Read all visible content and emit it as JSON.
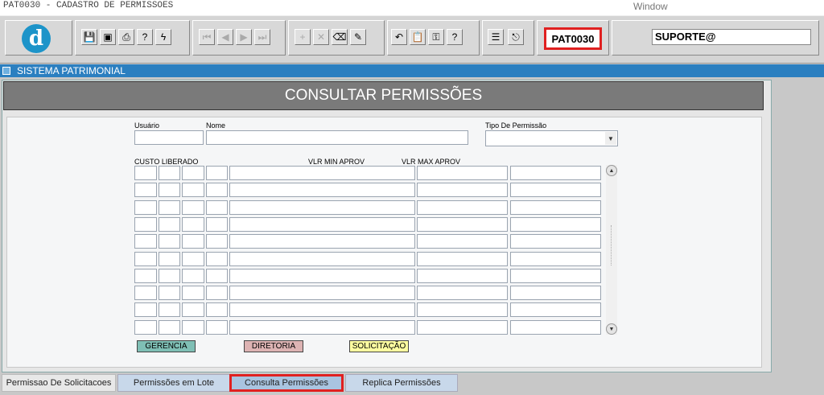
{
  "window": {
    "title": "PAT0030 - CADASTRO DE PERMISSOES",
    "menu_window": "Window"
  },
  "toolbar": {
    "program_code": "PAT0030",
    "user": "SUPORTE@",
    "logo_letter": "d",
    "buttons": [
      {
        "name": "save-icon",
        "glyph": "💾"
      },
      {
        "name": "screen-icon",
        "glyph": "▣"
      },
      {
        "name": "print-icon",
        "glyph": "⎙"
      },
      {
        "name": "query-icon",
        "glyph": "?"
      },
      {
        "name": "execute-icon",
        "glyph": "ϟ"
      },
      {
        "name": "first-record-icon",
        "glyph": "⏮"
      },
      {
        "name": "prev-record-icon",
        "glyph": "◀"
      },
      {
        "name": "next-record-icon",
        "glyph": "▶"
      },
      {
        "name": "last-record-icon",
        "glyph": "⏭"
      },
      {
        "name": "insert-record-icon",
        "glyph": "+"
      },
      {
        "name": "delete-record-icon",
        "glyph": "✕"
      },
      {
        "name": "clear-record-icon",
        "glyph": "⌫"
      },
      {
        "name": "edit-icon",
        "glyph": "✎"
      },
      {
        "name": "undo-icon",
        "glyph": "↶"
      },
      {
        "name": "clipboard-icon",
        "glyph": "📋"
      },
      {
        "name": "key-icon",
        "glyph": "⚿"
      },
      {
        "name": "help-icon",
        "glyph": "?"
      },
      {
        "name": "menu-icon",
        "glyph": "☰"
      },
      {
        "name": "exit-icon",
        "glyph": "⎋"
      }
    ]
  },
  "system": {
    "label": "SISTEMA PATRIMONIAL"
  },
  "page": {
    "title": "CONSULTAR PERMISSÕES"
  },
  "form": {
    "usuario_label": "Usuário",
    "nome_label": "Nome",
    "tipo_label": "Tipo De Permissão",
    "custo_label": "CUSTO LIBERADO",
    "vlr_min_label": "VLR MIN APROV",
    "vlr_max_label": "VLR MAX APROV",
    "usuario_value": "",
    "nome_value": "",
    "tipo_value": ""
  },
  "legend": {
    "gerencia": "GERENCIA",
    "diretoria": "DIRETORIA",
    "solicitacao": "SOLICITAÇÃO"
  },
  "colors": {
    "gerencia": "#7fbfb5",
    "diretoria": "#ddb3b3",
    "solicitacao": "#fdfda0",
    "highlight": "#e02020"
  },
  "tabs": [
    {
      "label": "Permissao De Solicitacoes",
      "active": false
    },
    {
      "label": "Permissões em Lote",
      "active": false
    },
    {
      "label": "Consulta Permissões",
      "active": true
    },
    {
      "label": "Replica Permissões",
      "active": false
    }
  ]
}
